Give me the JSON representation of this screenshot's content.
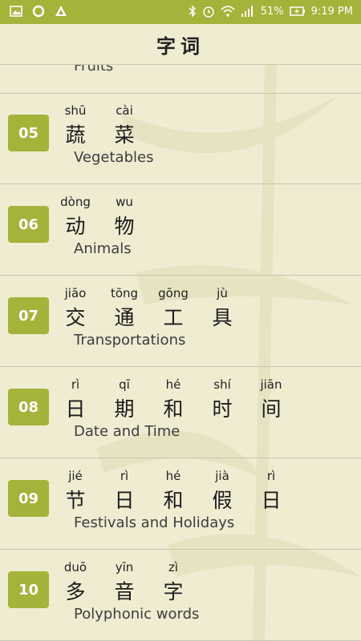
{
  "status": {
    "battery": "51%",
    "time": "9:19 PM",
    "left_icons": [
      "image-icon",
      "circle-icon",
      "triangle-icon"
    ],
    "right_icons": [
      "bluetooth-icon",
      "alarm-icon",
      "wifi-icon",
      "signal-icon",
      "battery-icon"
    ]
  },
  "header": {
    "title": "字词"
  },
  "partial": {
    "en": "Fruits"
  },
  "items": [
    {
      "num": "05",
      "chars": [
        {
          "py": "shū",
          "hz": "蔬"
        },
        {
          "py": "cài",
          "hz": "菜"
        }
      ],
      "en": "Vegetables"
    },
    {
      "num": "06",
      "chars": [
        {
          "py": "dòng",
          "hz": "动"
        },
        {
          "py": "wu",
          "hz": "物"
        }
      ],
      "en": "Animals"
    },
    {
      "num": "07",
      "chars": [
        {
          "py": "jiāo",
          "hz": "交"
        },
        {
          "py": "tōng",
          "hz": "通"
        },
        {
          "py": "gōng",
          "hz": "工"
        },
        {
          "py": "jù",
          "hz": "具"
        }
      ],
      "en": "Transportations"
    },
    {
      "num": "08",
      "chars": [
        {
          "py": "rì",
          "hz": "日"
        },
        {
          "py": "qī",
          "hz": "期"
        },
        {
          "py": "hé",
          "hz": "和"
        },
        {
          "py": "shí",
          "hz": "时"
        },
        {
          "py": "jiān",
          "hz": "间"
        }
      ],
      "en": "Date and Time"
    },
    {
      "num": "09",
      "chars": [
        {
          "py": "jié",
          "hz": "节"
        },
        {
          "py": "rì",
          "hz": "日"
        },
        {
          "py": "hé",
          "hz": "和"
        },
        {
          "py": "jià",
          "hz": "假"
        },
        {
          "py": "rì",
          "hz": "日"
        }
      ],
      "en": "Festivals and Holidays"
    },
    {
      "num": "10",
      "chars": [
        {
          "py": "duō",
          "hz": "多"
        },
        {
          "py": "yīn",
          "hz": "音"
        },
        {
          "py": "zì",
          "hz": "字"
        }
      ],
      "en": "Polyphonic words"
    }
  ],
  "colors": {
    "accent": "#a4b33a",
    "background": "#efecd2"
  }
}
